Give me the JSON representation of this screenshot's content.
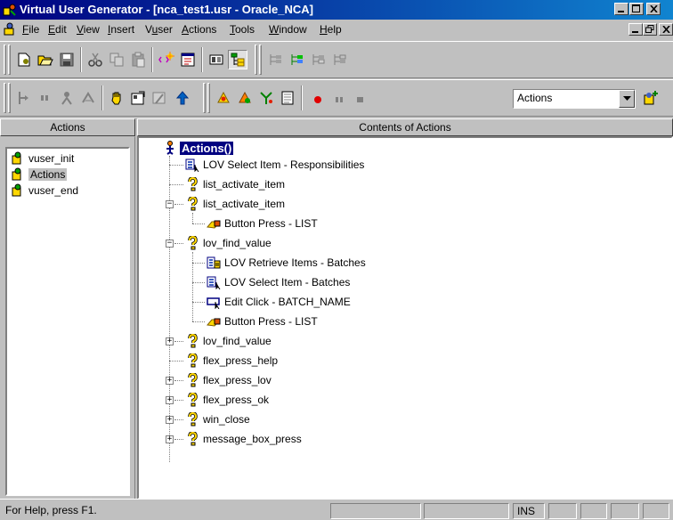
{
  "window": {
    "title": "Virtual User Generator - [nca_test1.usr - Oracle_NCA]",
    "title_gradient_start": "#000080",
    "title_gradient_end": "#1084d0"
  },
  "menu": {
    "items": [
      "File",
      "Edit",
      "View",
      "Insert",
      "Vuser",
      "Actions",
      "Tools",
      "Window",
      "Help"
    ],
    "mnemonics": [
      "F",
      "E",
      "V",
      "I",
      "u",
      "A",
      "T",
      "W",
      "H"
    ]
  },
  "toolbar": {
    "combo_value": "Actions"
  },
  "left_panel": {
    "header": "Actions",
    "items": [
      "vuser_init",
      "Actions",
      "vuser_end"
    ],
    "selected_index": 1
  },
  "right_panel": {
    "header": "Contents of Actions",
    "root": "Actions()",
    "nodes": [
      {
        "label": "LOV Select Item - Responsibilities",
        "icon": "lov-select-icon"
      },
      {
        "label": "list_activate_item",
        "icon": "function-icon"
      },
      {
        "label": "list_activate_item",
        "icon": "function-icon",
        "expanded": true
      },
      {
        "label": "Button Press - LIST",
        "icon": "button-press-icon"
      },
      {
        "label": "lov_find_value",
        "icon": "function-icon",
        "expanded": true
      },
      {
        "label": "LOV Retrieve Items - Batches",
        "icon": "lov-retrieve-icon"
      },
      {
        "label": "LOV Select Item - Batches",
        "icon": "lov-select-icon"
      },
      {
        "label": "Edit Click - BATCH_NAME",
        "icon": "edit-click-icon"
      },
      {
        "label": "Button Press - LIST",
        "icon": "button-press-icon"
      },
      {
        "label": "lov_find_value",
        "icon": "function-icon",
        "expanded": false
      },
      {
        "label": "flex_press_help",
        "icon": "function-icon"
      },
      {
        "label": "flex_press_lov",
        "icon": "function-icon",
        "expanded": false
      },
      {
        "label": "flex_press_ok",
        "icon": "function-icon",
        "expanded": false
      },
      {
        "label": "win_close",
        "icon": "function-icon",
        "expanded": false
      },
      {
        "label": "message_box_press",
        "icon": "function-icon",
        "expanded": false
      }
    ]
  },
  "status": {
    "text": "For Help, press F1.",
    "ins": "INS"
  },
  "colors": {
    "selection": "#000080",
    "face": "#c0c0c0",
    "window": "#ffffff"
  }
}
